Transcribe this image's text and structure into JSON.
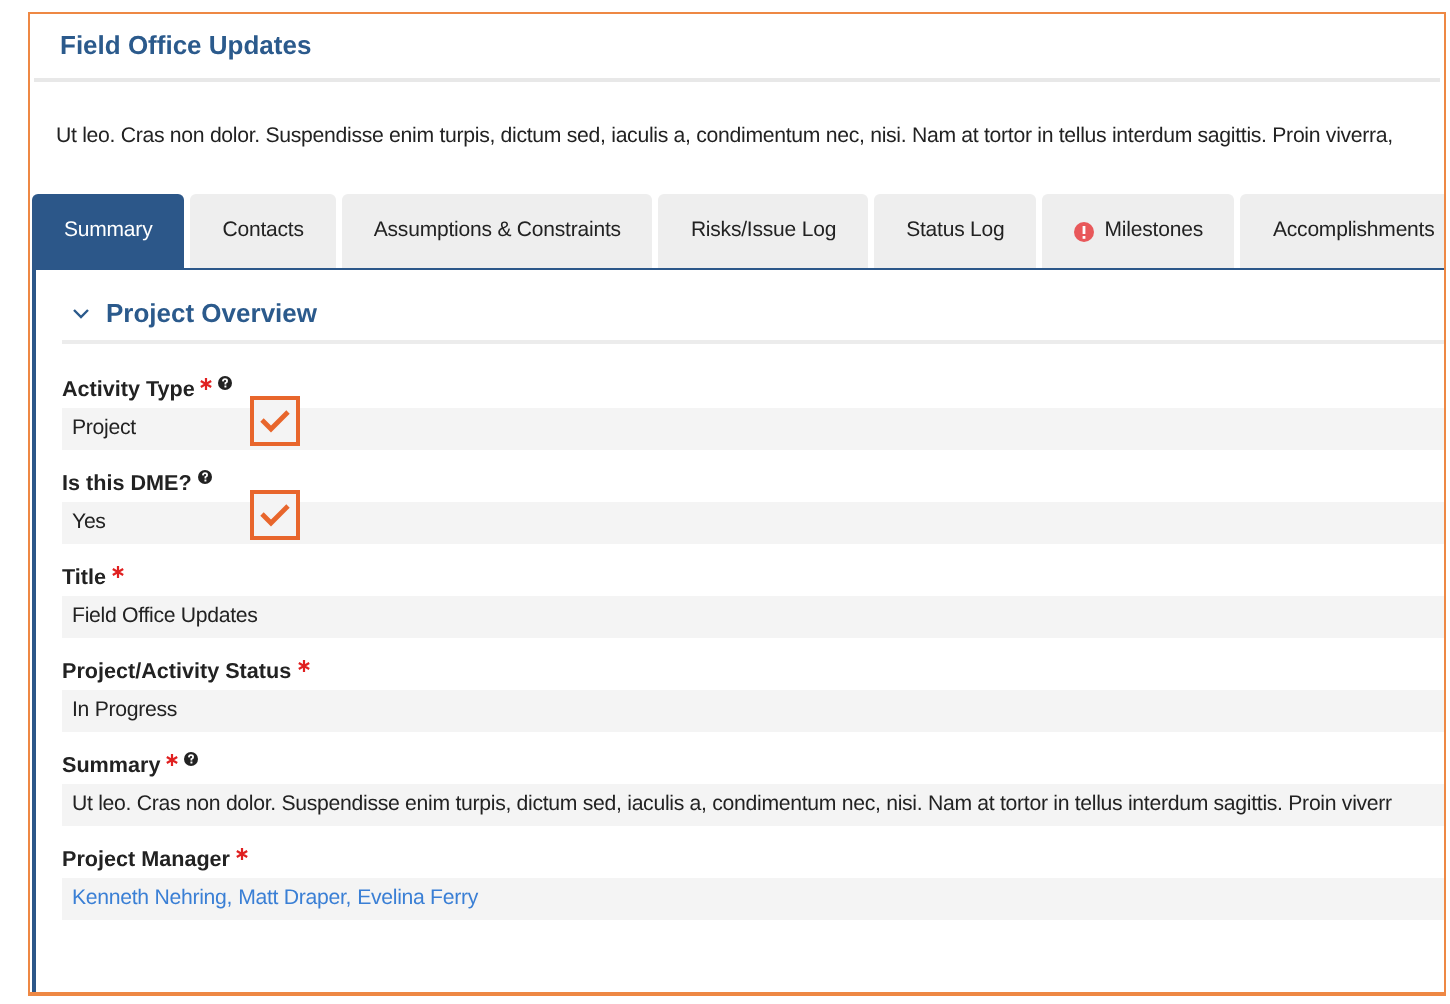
{
  "page": {
    "title": "Field Office Updates",
    "description": "Ut leo. Cras non dolor. Suspendisse enim turpis, dictum sed, iaculis a, condimentum nec, nisi. Nam at tortor in tellus interdum sagittis. Proin viverra,"
  },
  "tabs": [
    {
      "label": "Summary",
      "selected": true,
      "alert": false
    },
    {
      "label": "Contacts",
      "selected": false,
      "alert": false
    },
    {
      "label": "Assumptions & Constraints",
      "selected": false,
      "alert": false
    },
    {
      "label": "Risks/Issue Log",
      "selected": false,
      "alert": false
    },
    {
      "label": "Status Log",
      "selected": false,
      "alert": false
    },
    {
      "label": "Milestones",
      "selected": false,
      "alert": true
    },
    {
      "label": "Accomplishments",
      "selected": false,
      "alert": false
    }
  ],
  "section": {
    "title": "Project Overview",
    "expanded": true
  },
  "fields": [
    {
      "label": "Activity Type",
      "required": true,
      "help": true,
      "kind": "text",
      "value": "Project",
      "annotated": true
    },
    {
      "label": "Is this DME?",
      "required": false,
      "help": true,
      "kind": "text",
      "value": "Yes",
      "annotated": true
    },
    {
      "label": "Title",
      "required": true,
      "help": false,
      "kind": "text",
      "value": "Field Office Updates",
      "annotated": false
    },
    {
      "label": "Project/Activity Status",
      "required": true,
      "help": false,
      "kind": "text",
      "value": "In Progress",
      "annotated": false
    },
    {
      "label": "Summary",
      "required": true,
      "help": true,
      "kind": "text",
      "value": "Ut leo. Cras non dolor. Suspendisse enim turpis, dictum sed, iaculis a, condimentum nec, nisi. Nam at tortor in tellus interdum sagittis. Proin viverr",
      "annotated": false
    },
    {
      "label": "Project Manager",
      "required": true,
      "help": false,
      "kind": "links",
      "links": [
        "Kenneth Nehring,",
        "Matt Draper,",
        "Evelina Ferry"
      ],
      "annotated": false
    }
  ]
}
